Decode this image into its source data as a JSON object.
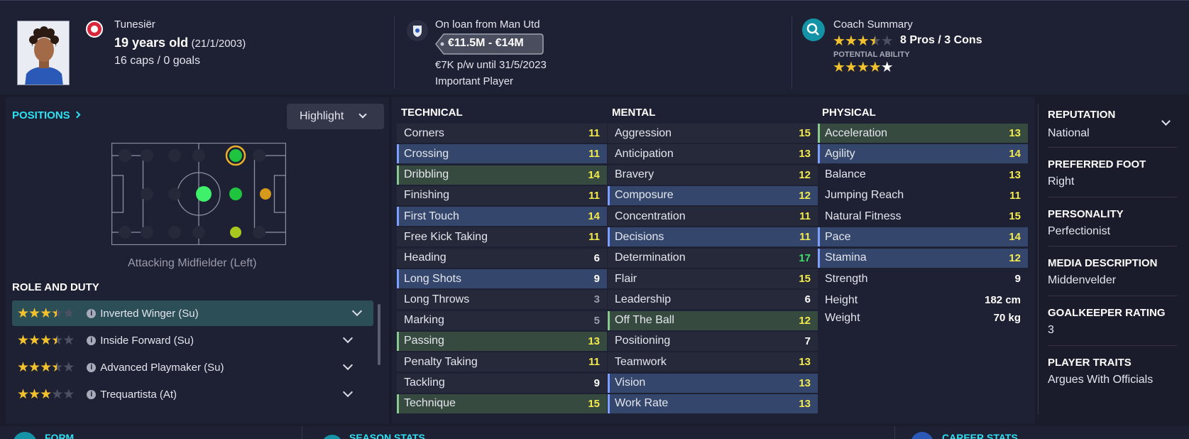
{
  "header": {
    "nationality": "Tunesiër",
    "age": "19 years old",
    "dob": "(21/1/2003)",
    "caps": "16 caps / 0 goals",
    "loan": "On loan from Man Utd",
    "value": "€11.5M - €14M",
    "wage": "€7K p/w until 31/5/2023",
    "status": "Important Player",
    "coach_summary": "Coach Summary",
    "pros_cons": "8 Pros / 3 Cons",
    "potential_label": "POTENTIAL ABILITY",
    "current_ability_stars": 3.5,
    "potential_ability_stars": 4.5
  },
  "positions": {
    "label": "POSITIONS",
    "highlight_button": "Highlight",
    "position_caption": "Attacking Midfielder (Left)"
  },
  "role_duty": {
    "label": "ROLE AND DUTY",
    "roles": [
      {
        "name": "Inverted Winger (Su)",
        "stars": 3.5,
        "selected": true
      },
      {
        "name": "Inside Forward (Su)",
        "stars": 3.5,
        "selected": false
      },
      {
        "name": "Advanced Playmaker (Su)",
        "stars": 3.5,
        "selected": false
      },
      {
        "name": "Trequartista (At)",
        "stars": 3,
        "selected": false
      }
    ]
  },
  "technical": {
    "title": "TECHNICAL",
    "attrs": [
      {
        "name": "Corners",
        "value": "11",
        "hl": "none"
      },
      {
        "name": "Crossing",
        "value": "11",
        "hl": "blue"
      },
      {
        "name": "Dribbling",
        "value": "14",
        "hl": "green"
      },
      {
        "name": "Finishing",
        "value": "11",
        "hl": "none"
      },
      {
        "name": "First Touch",
        "value": "14",
        "hl": "blue"
      },
      {
        "name": "Free Kick Taking",
        "value": "11",
        "hl": "none"
      },
      {
        "name": "Heading",
        "value": "6",
        "hl": "none"
      },
      {
        "name": "Long Shots",
        "value": "9",
        "hl": "blue"
      },
      {
        "name": "Long Throws",
        "value": "3",
        "hl": "none"
      },
      {
        "name": "Marking",
        "value": "5",
        "hl": "none"
      },
      {
        "name": "Passing",
        "value": "13",
        "hl": "green"
      },
      {
        "name": "Penalty Taking",
        "value": "11",
        "hl": "none"
      },
      {
        "name": "Tackling",
        "value": "9",
        "hl": "none"
      },
      {
        "name": "Technique",
        "value": "15",
        "hl": "green"
      }
    ]
  },
  "mental": {
    "title": "MENTAL",
    "attrs": [
      {
        "name": "Aggression",
        "value": "15",
        "hl": "none"
      },
      {
        "name": "Anticipation",
        "value": "13",
        "hl": "none"
      },
      {
        "name": "Bravery",
        "value": "12",
        "hl": "none"
      },
      {
        "name": "Composure",
        "value": "12",
        "hl": "blue"
      },
      {
        "name": "Concentration",
        "value": "11",
        "hl": "none"
      },
      {
        "name": "Decisions",
        "value": "11",
        "hl": "blue"
      },
      {
        "name": "Determination",
        "value": "17",
        "hl": "none"
      },
      {
        "name": "Flair",
        "value": "15",
        "hl": "none"
      },
      {
        "name": "Leadership",
        "value": "6",
        "hl": "none"
      },
      {
        "name": "Off The Ball",
        "value": "12",
        "hl": "green"
      },
      {
        "name": "Positioning",
        "value": "7",
        "hl": "none"
      },
      {
        "name": "Teamwork",
        "value": "13",
        "hl": "none"
      },
      {
        "name": "Vision",
        "value": "13",
        "hl": "blue"
      },
      {
        "name": "Work Rate",
        "value": "13",
        "hl": "blue"
      }
    ]
  },
  "physical": {
    "title": "PHYSICAL",
    "attrs": [
      {
        "name": "Acceleration",
        "value": "13",
        "hl": "green"
      },
      {
        "name": "Agility",
        "value": "14",
        "hl": "blue"
      },
      {
        "name": "Balance",
        "value": "13",
        "hl": "none"
      },
      {
        "name": "Jumping Reach",
        "value": "11",
        "hl": "none"
      },
      {
        "name": "Natural Fitness",
        "value": "15",
        "hl": "none"
      },
      {
        "name": "Pace",
        "value": "14",
        "hl": "blue"
      },
      {
        "name": "Stamina",
        "value": "12",
        "hl": "blue"
      },
      {
        "name": "Strength",
        "value": "9",
        "hl": "none"
      }
    ],
    "height_label": "Height",
    "height": "182 cm",
    "weight_label": "Weight",
    "weight": "70 kg"
  },
  "side": {
    "reputation_label": "REPUTATION",
    "reputation": "National",
    "foot_label": "PREFERRED FOOT",
    "foot": "Right",
    "personality_label": "PERSONALITY",
    "personality": "Perfectionist",
    "media_label": "MEDIA DESCRIPTION",
    "media": "Middenvelder",
    "gk_label": "GOALKEEPER RATING",
    "gk": "3",
    "traits_label": "PLAYER TRAITS",
    "traits": "Argues With Officials"
  },
  "bottom": {
    "form": "FORM",
    "season": "SEASON STATS",
    "career": "CAREER STATS"
  },
  "colors": {
    "accent_cyan": "#2ee0f2",
    "value_yellow": "#f3ea4c",
    "value_green": "#3ee06a",
    "value_white": "#ffffff",
    "value_gray": "#9a9cab"
  }
}
